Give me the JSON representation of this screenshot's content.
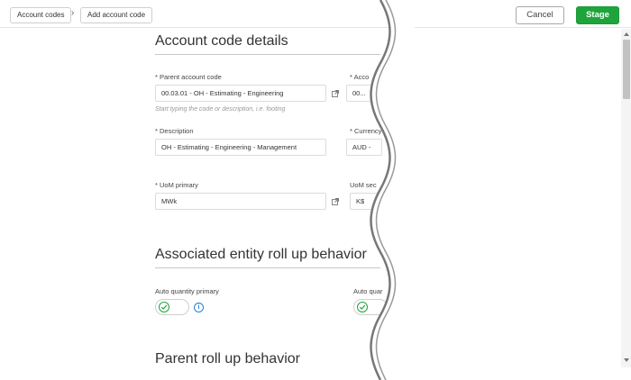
{
  "breadcrumb": {
    "items": [
      "Account codes",
      "Add account code"
    ],
    "separator": "›"
  },
  "toolbar": {
    "cancel_label": "Cancel",
    "stage_label": "Stage"
  },
  "sections": {
    "details": {
      "title": "Account code details",
      "parent_code": {
        "label": "* Parent account code",
        "value": "00.03.01 - OH - Estimating - Engineering",
        "hint": "Start typing the code or description, i.e. footing"
      },
      "account_code": {
        "label": "* Acco",
        "value": "00..."
      },
      "description": {
        "label": "* Description",
        "value": "OH - Estimating - Engineering - Management"
      },
      "currency": {
        "label": "* Currency",
        "value": "AUD -"
      },
      "uom_primary": {
        "label": "* UoM primary",
        "value": "MWk"
      },
      "uom_secondary": {
        "label": "UoM sec",
        "value": "K$"
      }
    },
    "entity_rollup": {
      "title": "Associated entity roll up behavior",
      "auto_qty_primary": {
        "label": "Auto quantity primary"
      },
      "auto_qty_secondary": {
        "label": "Auto quar"
      }
    },
    "parent_rollup": {
      "title": "Parent roll up behavior"
    }
  },
  "colors": {
    "accent": "#1fa43b",
    "info": "#2a7fd4"
  }
}
